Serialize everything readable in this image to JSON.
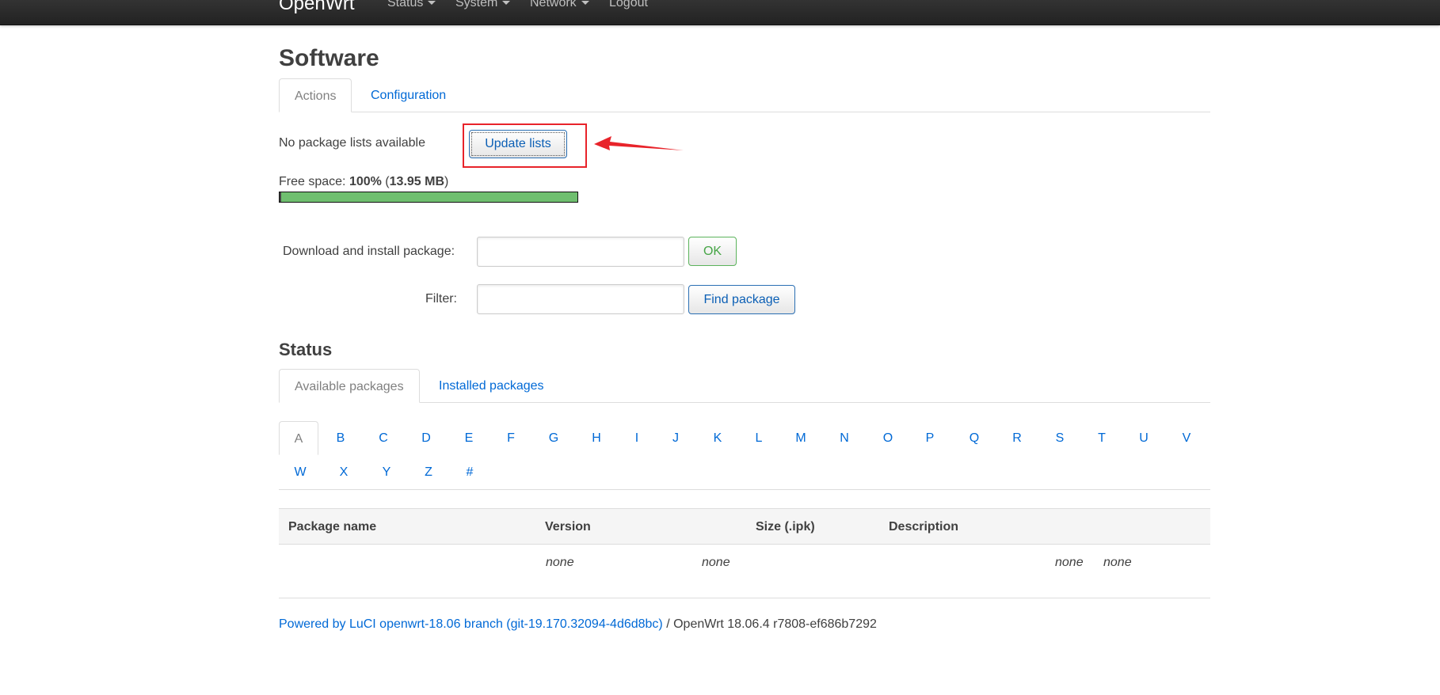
{
  "navbar": {
    "brand": "OpenWrt",
    "items": [
      "Status",
      "System",
      "Network",
      "Logout"
    ]
  },
  "page": {
    "title": "Software",
    "tabs": [
      "Actions",
      "Configuration"
    ],
    "active_tab": "Actions"
  },
  "actions": {
    "package_lists_status": "No package lists available",
    "update_button": "Update lists",
    "free_space_label": "Free space: ",
    "free_space_percent": "100%",
    "free_space_open": " (",
    "free_space_size": "13.95 MB",
    "free_space_close": ")",
    "free_space_fraction": 1.0,
    "download_label": "Download and install package:",
    "download_value": "",
    "ok_button": "OK",
    "filter_label": "Filter:",
    "filter_value": "",
    "find_button": "Find package"
  },
  "status": {
    "title": "Status",
    "tabs": [
      "Available packages",
      "Installed packages"
    ],
    "active_tab": "Available packages",
    "letters_row1": [
      "A",
      "B",
      "C",
      "D",
      "E",
      "F",
      "G",
      "H",
      "I",
      "J",
      "K",
      "L",
      "M",
      "N",
      "O",
      "P",
      "Q",
      "R",
      "S",
      "T",
      "U",
      "V"
    ],
    "letters_row2": [
      "W",
      "X",
      "Y",
      "Z",
      "#"
    ],
    "active_letter": "A",
    "table": {
      "headers": [
        "Package name",
        "Version",
        "Size (.ipk)",
        "Description"
      ],
      "row": [
        "none",
        "none",
        "none",
        "none"
      ]
    }
  },
  "footer": {
    "link_text": "Powered by LuCI openwrt-18.06 branch (git-19.170.32094-4d6d8bc)",
    "separator": " / ",
    "version_text": "OpenWrt 18.06.4 r7808-ef686b7292"
  },
  "colors": {
    "link": "#0069d6",
    "highlight": "#e8232a",
    "progress": "#6fbf6f",
    "ok_green": "#46a546"
  }
}
